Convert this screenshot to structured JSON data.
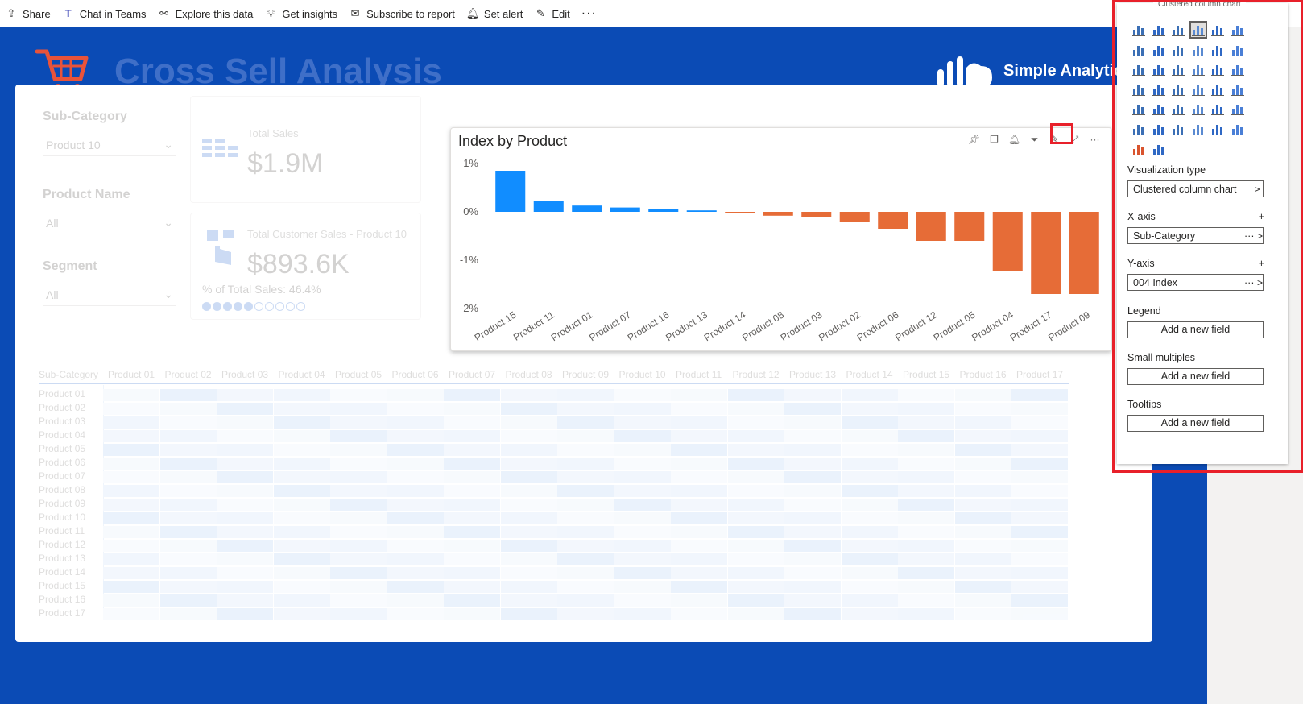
{
  "toolbar": {
    "share": "Share",
    "chat": "Chat in Teams",
    "explore": "Explore this data",
    "insights": "Get insights",
    "subscribe": "Subscribe to report",
    "alert": "Set alert",
    "edit": "Edit",
    "more": "···"
  },
  "report": {
    "title": "Cross Sell Analysis",
    "brand": "Simple Analytic"
  },
  "slicers": {
    "sub_category_label": "Sub-Category",
    "sub_category_value": "Product 10",
    "product_name_label": "Product Name",
    "product_name_value": "All",
    "segment_label": "Segment",
    "segment_value": "All"
  },
  "cards": {
    "total_sales_label": "Total Sales",
    "total_sales_value": "$1.9M",
    "customer_sales_label": "Total Customer Sales - Product 10",
    "customer_sales_value": "$893.6K",
    "pct_label": "% of Total Sales: 46.4%"
  },
  "chart_data": {
    "type": "bar",
    "title": "Index by Product",
    "categories": [
      "Product 15",
      "Product 11",
      "Product 01",
      "Product 07",
      "Product 16",
      "Product 13",
      "Product 14",
      "Product 08",
      "Product 03",
      "Product 02",
      "Product 06",
      "Product 12",
      "Product 05",
      "Product 04",
      "Product 17",
      "Product 09"
    ],
    "values": [
      0.85,
      0.22,
      0.13,
      0.09,
      0.05,
      0.03,
      -0.02,
      -0.08,
      -0.1,
      -0.2,
      -0.35,
      -0.6,
      -0.6,
      -1.22,
      -1.7,
      -1.7
    ],
    "y_ticks": [
      "1%",
      "0%",
      "-1%",
      "-2%"
    ],
    "ylim": [
      -2,
      1
    ],
    "colors": {
      "positive": "#118dff",
      "negative": "#e66c37"
    }
  },
  "chart_toolbar_icons": [
    "pin-icon",
    "copy-icon",
    "bell-icon",
    "filter-icon",
    "format-visual-icon",
    "focus-mode-icon",
    "more-options-icon"
  ],
  "matrix": {
    "header": "Sub-Category",
    "columns": [
      "Product 01",
      "Product 02",
      "Product 03",
      "Product 04",
      "Product 05",
      "Product 06",
      "Product 07",
      "Product 08",
      "Product 09",
      "Product 10",
      "Product 11",
      "Product 12",
      "Product 13",
      "Product 14",
      "Product 15",
      "Product 16",
      "Product 17"
    ],
    "rows": [
      "Product 01",
      "Product 02",
      "Product 03",
      "Product 04",
      "Product 05",
      "Product 06",
      "Product 07",
      "Product 08",
      "Product 09",
      "Product 10",
      "Product 11",
      "Product 12",
      "Product 13",
      "Product 14",
      "Product 15",
      "Product 16",
      "Product 17"
    ]
  },
  "viz_pane": {
    "tooltip": "Clustered column chart",
    "visualization_type_label": "Visualization type",
    "visualization_type_value": "Clustered column chart",
    "x_axis_label": "X-axis",
    "x_axis_value": "Sub-Category",
    "y_axis_label": "Y-axis",
    "y_axis_value": "004 Index",
    "legend_label": "Legend",
    "small_multiples_label": "Small multiples",
    "tooltips_label": "Tooltips",
    "add_field": "Add a new field",
    "plus": "+",
    "ellipsis": "···",
    "chevron": ">"
  }
}
